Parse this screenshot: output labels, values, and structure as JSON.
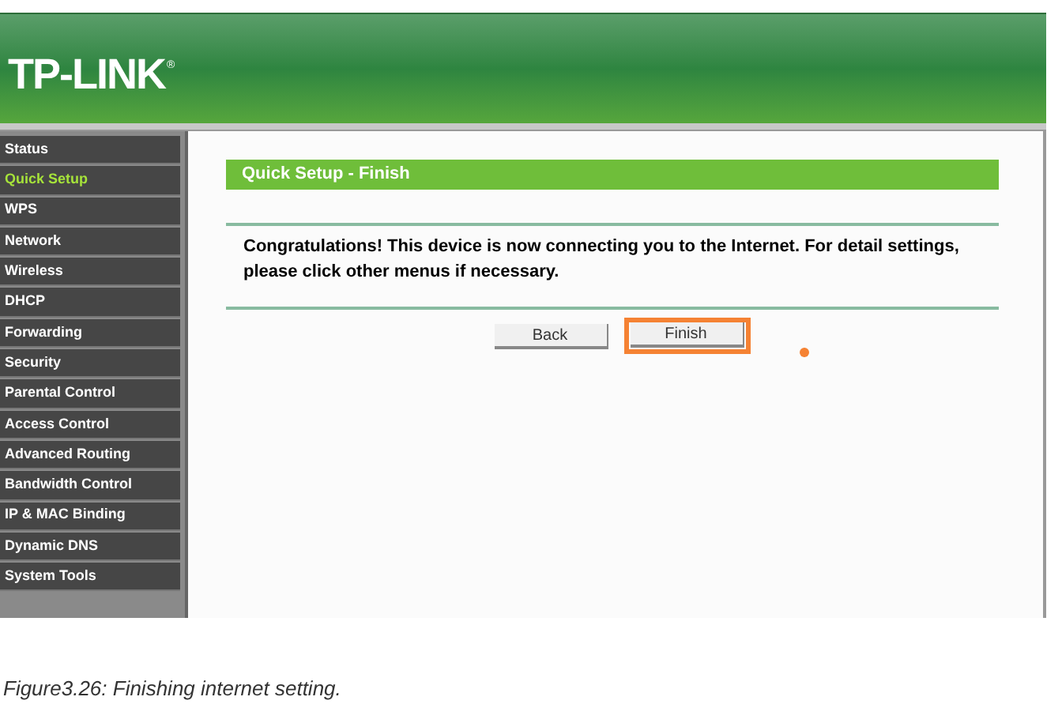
{
  "header": {
    "logo": "TP-LINK",
    "registered_mark": "®"
  },
  "sidebar": {
    "items": [
      {
        "label": "Status",
        "selected": false
      },
      {
        "label": "Quick Setup",
        "selected": true
      },
      {
        "label": "WPS",
        "selected": false
      },
      {
        "label": "Network",
        "selected": false
      },
      {
        "label": "Wireless",
        "selected": false
      },
      {
        "label": "DHCP",
        "selected": false
      },
      {
        "label": "Forwarding",
        "selected": false
      },
      {
        "label": "Security",
        "selected": false
      },
      {
        "label": "Parental Control",
        "selected": false
      },
      {
        "label": "Access Control",
        "selected": false
      },
      {
        "label": "Advanced Routing",
        "selected": false
      },
      {
        "label": "Bandwidth Control",
        "selected": false
      },
      {
        "label": "IP & MAC Binding",
        "selected": false
      },
      {
        "label": "Dynamic DNS",
        "selected": false
      },
      {
        "label": "System Tools",
        "selected": false
      }
    ]
  },
  "panel": {
    "title": "Quick Setup - Finish",
    "message": "Congratulations! This device is now connecting you to the Internet. For detail settings, please click other menus if necessary.",
    "buttons": [
      {
        "label": "Back",
        "highlighted": false
      },
      {
        "label": "Finish",
        "highlighted": true
      }
    ]
  },
  "caption": "Figure3.26: Finishing internet setting."
}
